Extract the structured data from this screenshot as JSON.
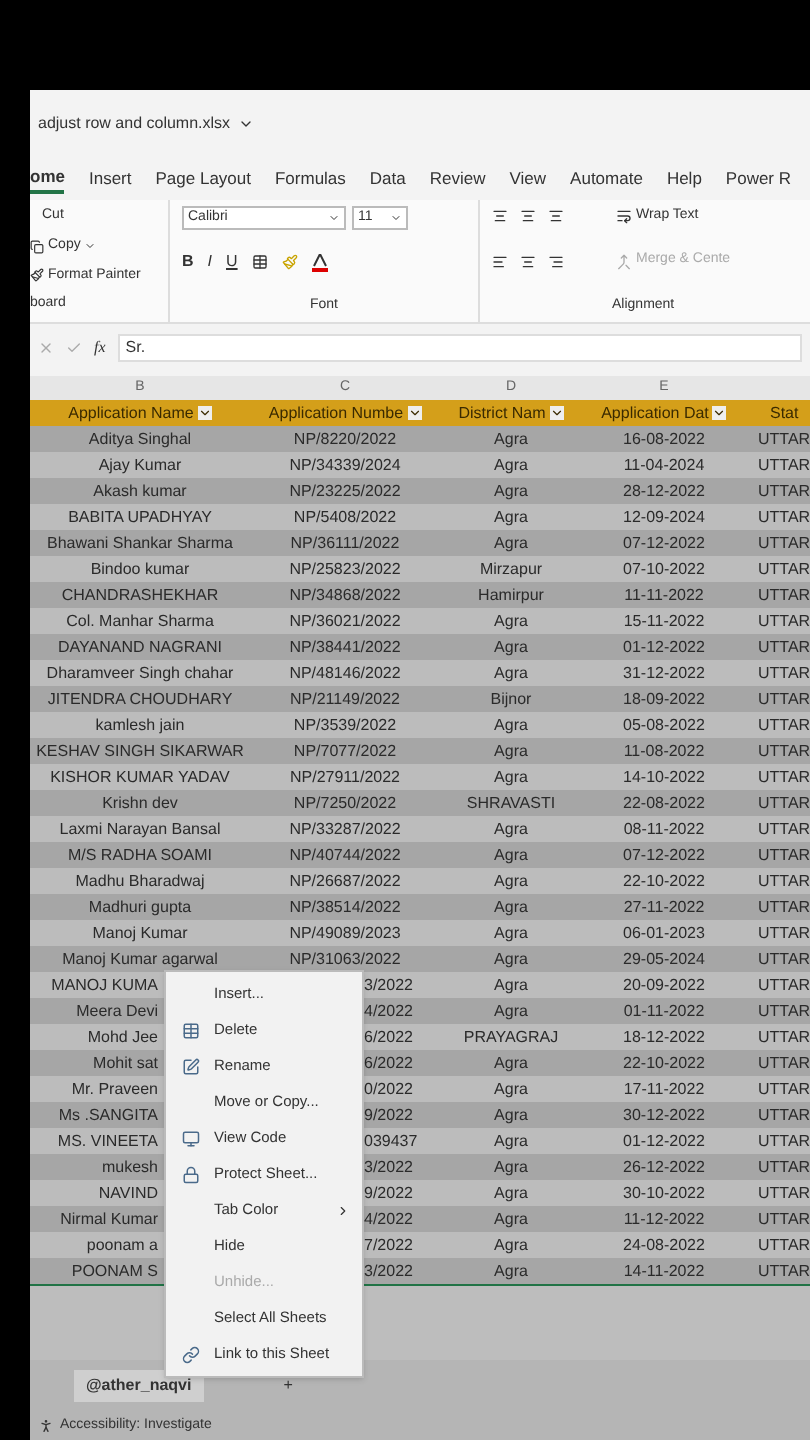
{
  "window": {
    "title": "adjust row and column.xlsx"
  },
  "ribbon_tabs": [
    {
      "label": "ome",
      "selected": true
    },
    {
      "label": "Insert",
      "selected": false
    },
    {
      "label": "Page Layout",
      "selected": false
    },
    {
      "label": "Formulas",
      "selected": false
    },
    {
      "label": "Data",
      "selected": false
    },
    {
      "label": "Review",
      "selected": false
    },
    {
      "label": "View",
      "selected": false
    },
    {
      "label": "Automate",
      "selected": false
    },
    {
      "label": "Help",
      "selected": false
    },
    {
      "label": "Power R",
      "selected": false
    }
  ],
  "clipboard": {
    "items": [
      "Cut",
      "Copy",
      "Format Painter"
    ],
    "group_label": "board"
  },
  "font": {
    "name": "Calibri",
    "size": "11",
    "bold": "B",
    "italic": "I",
    "underline": "U",
    "group_label": "Font"
  },
  "alignment": {
    "wrap_text": "Wrap Text",
    "merge": "Merge & Cente",
    "group_label": "Alignment"
  },
  "formula_bar": {
    "function_label": "fx",
    "value": "Sr."
  },
  "column_headers": [
    "B",
    "C",
    "D",
    "E"
  ],
  "table": {
    "columns": [
      "Application Name",
      "Application Numbe",
      "District Nam",
      "Application  Dat",
      "Stat"
    ],
    "rows": [
      {
        "covered": false,
        "cells": [
          "Aditya Singhal",
          "NP/8220/2022",
          "Agra",
          "16-08-2022",
          "UTTAR"
        ]
      },
      {
        "covered": false,
        "cells": [
          "Ajay Kumar",
          "NP/34339/2024",
          "Agra",
          "11-04-2024",
          "UTTAR"
        ]
      },
      {
        "covered": false,
        "cells": [
          "Akash kumar",
          "NP/23225/2022",
          "Agra",
          "28-12-2022",
          "UTTAR"
        ]
      },
      {
        "covered": false,
        "cells": [
          "BABITA UPADHYAY",
          "NP/5408/2022",
          "Agra",
          "12-09-2024",
          "UTTAR"
        ]
      },
      {
        "covered": false,
        "cells": [
          "Bhawani Shankar Sharma",
          "NP/36111/2022",
          "Agra",
          "07-12-2022",
          "UTTAR"
        ]
      },
      {
        "covered": false,
        "cells": [
          "Bindoo kumar",
          "NP/25823/2022",
          "Mirzapur",
          "07-10-2022",
          "UTTAR"
        ]
      },
      {
        "covered": false,
        "cells": [
          "CHANDRASHEKHAR",
          "NP/34868/2022",
          "Hamirpur",
          "11-11-2022",
          "UTTAR"
        ]
      },
      {
        "covered": false,
        "cells": [
          "Col. Manhar Sharma",
          "NP/36021/2022",
          "Agra",
          "15-11-2022",
          "UTTAR"
        ]
      },
      {
        "covered": false,
        "cells": [
          "DAYANAND NAGRANI",
          "NP/38441/2022",
          "Agra",
          "01-12-2022",
          "UTTAR"
        ]
      },
      {
        "covered": false,
        "cells": [
          "Dharamveer Singh chahar",
          "NP/48146/2022",
          "Agra",
          "31-12-2022",
          "UTTAR"
        ]
      },
      {
        "covered": false,
        "cells": [
          "JITENDRA CHOUDHARY",
          "NP/21149/2022",
          "Bijnor",
          "18-09-2022",
          "UTTAR"
        ]
      },
      {
        "covered": false,
        "cells": [
          "kamlesh jain",
          "NP/3539/2022",
          "Agra",
          "05-08-2022",
          "UTTAR"
        ]
      },
      {
        "covered": false,
        "cells": [
          "KESHAV SINGH SIKARWAR",
          "NP/7077/2022",
          "Agra",
          "11-08-2022",
          "UTTAR"
        ]
      },
      {
        "covered": false,
        "cells": [
          "KISHOR KUMAR YADAV",
          "NP/27911/2022",
          "Agra",
          "14-10-2022",
          "UTTAR"
        ]
      },
      {
        "covered": false,
        "cells": [
          "Krishn dev",
          "NP/7250/2022",
          "SHRAVASTI",
          "22-08-2022",
          "UTTAR"
        ]
      },
      {
        "covered": false,
        "cells": [
          "Laxmi Narayan Bansal",
          "NP/33287/2022",
          "Agra",
          "08-11-2022",
          "UTTAR"
        ]
      },
      {
        "covered": false,
        "cells": [
          "M/S RADHA SOAMI",
          "NP/40744/2022",
          "Agra",
          "07-12-2022",
          "UTTAR"
        ]
      },
      {
        "covered": false,
        "cells": [
          "Madhu Bharadwaj",
          "NP/26687/2022",
          "Agra",
          "22-10-2022",
          "UTTAR"
        ]
      },
      {
        "covered": false,
        "cells": [
          "Madhuri gupta",
          "NP/38514/2022",
          "Agra",
          "27-11-2022",
          "UTTAR"
        ]
      },
      {
        "covered": false,
        "cells": [
          "Manoj Kumar",
          "NP/49089/2023",
          "Agra",
          "06-01-2023",
          "UTTAR"
        ]
      },
      {
        "covered": false,
        "cells": [
          "Manoj Kumar agarwal",
          "NP/31063/2022",
          "Agra",
          "29-05-2024",
          "UTTAR"
        ]
      },
      {
        "covered": true,
        "cells": [
          "MANOJ KUMA",
          "3/2022",
          "Agra",
          "20-09-2022",
          "UTTAR"
        ]
      },
      {
        "covered": true,
        "cells": [
          "Meera Devi",
          "4/2022",
          "Agra",
          "01-11-2022",
          "UTTAR"
        ]
      },
      {
        "covered": true,
        "cells": [
          "Mohd Jee",
          "6/2022",
          "PRAYAGRAJ",
          "18-12-2022",
          "UTTAR"
        ]
      },
      {
        "covered": true,
        "cells": [
          "Mohit sat",
          "6/2022",
          "Agra",
          "22-10-2022",
          "UTTAR"
        ]
      },
      {
        "covered": true,
        "cells": [
          "Mr. Praveen",
          "0/2022",
          "Agra",
          "17-11-2022",
          "UTTAR"
        ]
      },
      {
        "covered": true,
        "cells": [
          "Ms .SANGITA",
          "9/2022",
          "Agra",
          "30-12-2022",
          "UTTAR"
        ]
      },
      {
        "covered": true,
        "cells": [
          "MS. VINEETA",
          "039437",
          "Agra",
          "01-12-2022",
          "UTTAR"
        ]
      },
      {
        "covered": true,
        "cells": [
          "mukesh",
          "3/2022",
          "Agra",
          "26-12-2022",
          "UTTAR"
        ]
      },
      {
        "covered": true,
        "cells": [
          "NAVIND",
          "9/2022",
          "Agra",
          "30-10-2022",
          "UTTAR"
        ]
      },
      {
        "covered": true,
        "cells": [
          "Nirmal Kumar",
          "4/2022",
          "Agra",
          "11-12-2022",
          "UTTAR"
        ]
      },
      {
        "covered": true,
        "cells": [
          "poonam a",
          "7/2022",
          "Agra",
          "24-08-2022",
          "UTTAR"
        ]
      },
      {
        "covered": true,
        "cells": [
          "POONAM S",
          "3/2022",
          "Agra",
          "14-11-2022",
          "UTTAR"
        ]
      }
    ]
  },
  "context_menu": {
    "items": [
      {
        "label": "Insert...",
        "kind": "plain",
        "disabled": false,
        "submenu": false
      },
      {
        "label": "Delete",
        "kind": "icon",
        "disabled": false,
        "submenu": false
      },
      {
        "label": "Rename",
        "kind": "icon",
        "disabled": false,
        "submenu": false
      },
      {
        "label": "Move or Copy...",
        "kind": "plain",
        "disabled": false,
        "submenu": false
      },
      {
        "label": "View Code",
        "kind": "icon",
        "disabled": false,
        "submenu": false
      },
      {
        "label": "Protect Sheet...",
        "kind": "icon",
        "disabled": false,
        "submenu": false
      },
      {
        "label": "Tab Color",
        "kind": "plain",
        "disabled": false,
        "submenu": true
      },
      {
        "label": "Hide",
        "kind": "plain",
        "disabled": false,
        "submenu": false
      },
      {
        "label": "Unhide...",
        "kind": "plain",
        "disabled": true,
        "submenu": false
      },
      {
        "label": "Select All Sheets",
        "kind": "plain",
        "disabled": false,
        "submenu": false
      },
      {
        "label": "Link to this Sheet",
        "kind": "icon",
        "disabled": false,
        "submenu": false
      }
    ]
  },
  "sheet_tabs": [
    {
      "label": "@ather_naqvi",
      "selected": true
    }
  ],
  "add_sheet": "+",
  "status_bar": "Accessibility: Investigate"
}
